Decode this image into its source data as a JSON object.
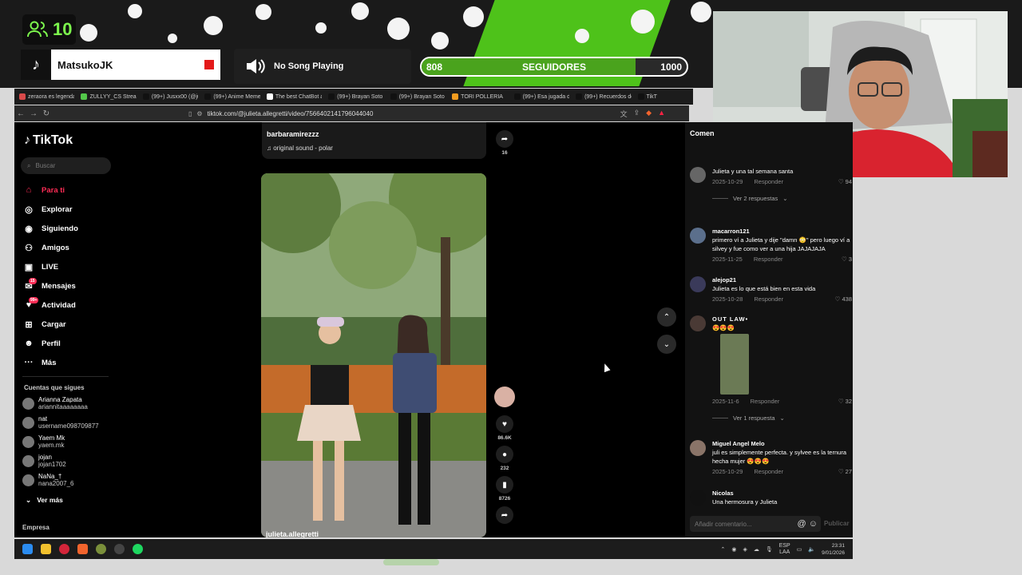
{
  "stream": {
    "viewer_count": "10",
    "channel": "MatsukoJK",
    "song": "No Song Playing",
    "followers": {
      "label": "SEGUIDORES",
      "current": "808",
      "goal": "1000",
      "progress": 0.808
    }
  },
  "tabs": [
    {
      "label": "zeraora es legendario",
      "color": "#d94a4a"
    },
    {
      "label": "ZULLYY_CS Stream - W",
      "color": "#53c84a"
    },
    {
      "label": "(99+) Jusxx00 (@jusxx0",
      "color": "#111111"
    },
    {
      "label": "(99+) Anime Memes fo",
      "color": "#111111"
    },
    {
      "label": "The best ChatBot and",
      "color": "#ffffff"
    },
    {
      "label": "(99+) Brayan Soto y ale",
      "color": "#111111"
    },
    {
      "label": "(99+) Brayan Soto y ale",
      "color": "#111111"
    },
    {
      "label": "TORI POLLERIA",
      "color": "#f29c1f"
    },
    {
      "label": "(99+) Esa jugada de gi",
      "color": "#111111"
    },
    {
      "label": "(99+) Recuerdos del M",
      "color": "#111111"
    },
    {
      "label": "TikT",
      "color": "#111111"
    }
  ],
  "address": {
    "url": "tiktok.com/@julieta.allegretti/video/7566402141796044040"
  },
  "tiktok": {
    "logo": "TikTok",
    "search_placeholder": "Buscar",
    "nav": [
      {
        "label": "Para ti",
        "icon": "home-icon",
        "active": true
      },
      {
        "label": "Explorar",
        "icon": "compass-icon"
      },
      {
        "label": "Siguiendo",
        "icon": "following-icon"
      },
      {
        "label": "Amigos",
        "icon": "friends-icon"
      },
      {
        "label": "LIVE",
        "icon": "live-icon"
      },
      {
        "label": "Mensajes",
        "icon": "message-icon",
        "badge": "15"
      },
      {
        "label": "Actividad",
        "icon": "activity-icon",
        "badge": "99+"
      },
      {
        "label": "Cargar",
        "icon": "upload-icon"
      },
      {
        "label": "Perfil",
        "icon": "profile-icon"
      },
      {
        "label": "Más",
        "icon": "more-icon"
      }
    ],
    "following_title": "Cuentas que sigues",
    "following": [
      {
        "name": "Arianna Zapata",
        "handle": "ariannitaaaaaaaa"
      },
      {
        "name": "nat",
        "handle": "username098709877"
      },
      {
        "name": "Yaem Mk",
        "handle": "yaem.mk"
      },
      {
        "name": "jojan",
        "handle": "jojan1702"
      },
      {
        "name": "NaNa_†",
        "handle": "nana2007_6"
      }
    ],
    "see_more": "Ver más",
    "footer": "Empresa",
    "prev_video": {
      "user": "barbaramirezzz",
      "sound": "original sound - polar",
      "shares": "16"
    },
    "video": {
      "user": "julieta.allegretti",
      "likes": "86.6K",
      "comments": "232",
      "saves": "8726"
    },
    "comments_title": "Comen",
    "comments": [
      {
        "text": "Julieta y una tal semana santa",
        "date": "2025-10-29",
        "reply": "Responder",
        "likes": "94",
        "replies": "Ver 2 respuestas"
      },
      {
        "name": "macarron121",
        "text": "primero ví a Julieta y dije \"damn 😳\" pero luego ví a silvey y fue como ver a una hija JAJAJAJA",
        "date": "2025-11-25",
        "reply": "Responder",
        "likes": "3"
      },
      {
        "name": "alejop21",
        "text": "Julieta es lo que está bien en esta vida",
        "date": "2025-10-28",
        "reply": "Responder",
        "likes": "438"
      },
      {
        "name": "OUT LAW•",
        "text": "😍😍😍",
        "date": "2025-11-6",
        "reply": "Responder",
        "likes": "32",
        "replies": "Ver 1 respuesta"
      },
      {
        "name": "Miguel Angel Melo",
        "text": "juli es simplemente perfecta. y sylvee es la ternura hecha mujer 😍😍😍",
        "date": "2025-10-29",
        "reply": "Responder",
        "likes": "27"
      },
      {
        "name": "Nicolas",
        "text": "Una hermosura y Julieta"
      }
    ],
    "comment_placeholder": "Añadir comentario...",
    "publish": "Publicar"
  },
  "taskbar": {
    "lang": "ESP",
    "lang2": "LAA",
    "time": "23:31",
    "date": "9/01/2026"
  }
}
